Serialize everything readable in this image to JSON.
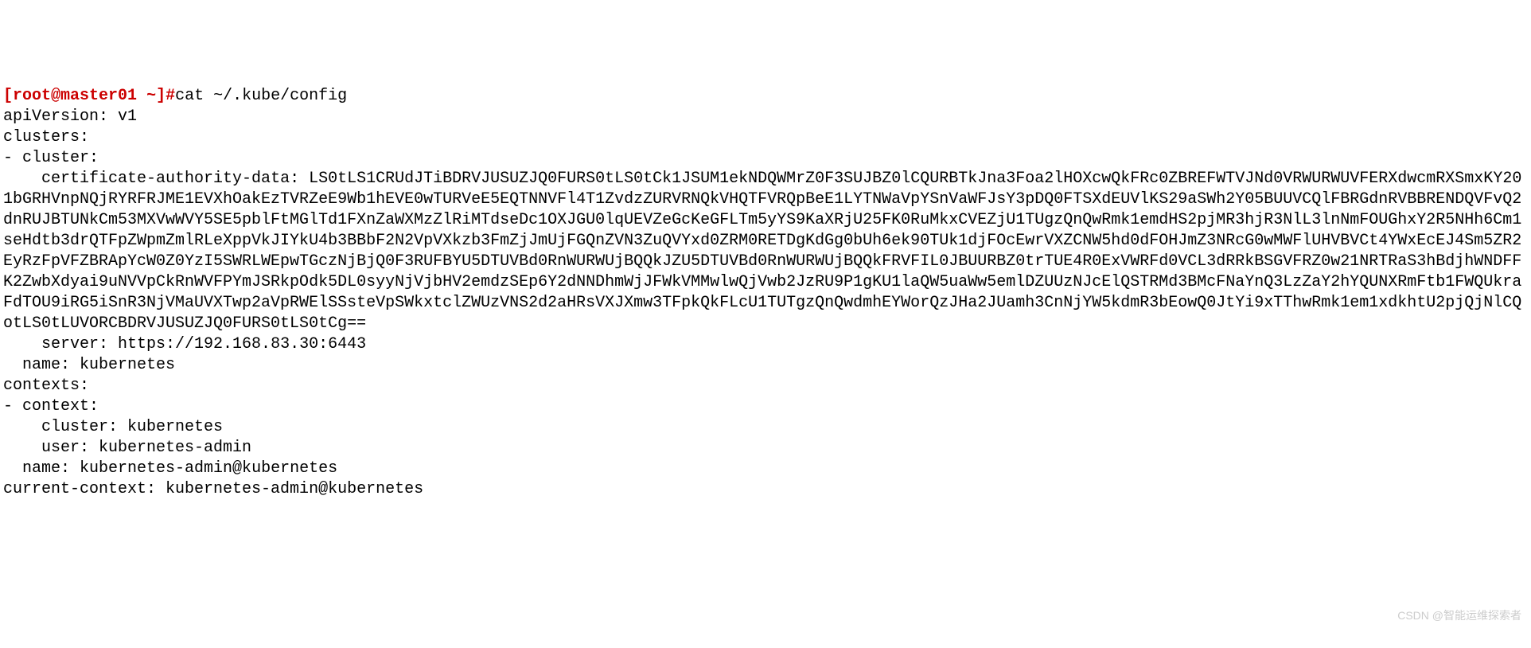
{
  "prompt": {
    "open_bracket": "[",
    "user": "root",
    "at": "@",
    "host": "master01",
    "path": " ~",
    "close_bracket": "]",
    "hash": "#"
  },
  "command": "cat ~/.kube/config",
  "output": {
    "line1": "apiVersion: v1",
    "line2": "clusters:",
    "line3": "- cluster:",
    "line4": "    certificate-authority-data: LS0tLS1CRUdJTiBDRVJUSUZJQ0FURS0tLS0tCk1JSUM1ekNDQWMrZ0F3SUJBZ0lCQURBTkJna3Foa2lHOXcwQkFRc0ZBREFWTVJNd0VRWURWUVFERXdwcmRXSmxKY201bGRHVnpNQjRYRFRJME1EVXhOakEzTVRZeE9Wb1hEVE0wTURVeE5EQTNNVFl4T1ZvdzZURVRNQkVHQTFVRQpBeE1LYTNWaVpYSnVaWFJsY3pDQ0FTSXdEUVlKS29aSWh2Y05BUUVCQlFBRGdnRVBBRENDQVFvQ2dnRUJBTUNkCm53MXVwWVY5SE5pblFtMGlTd1FXnZaWXMzZlRiMTdseDc1OXJGU0lqUEVZeGcKeGFLTm5yYS9KaXRjU25FK0RuMkxCVEZjU1TUgzQnQwRmk1emdHS2pjMR3hjR3NlL3lnNmFOUGhxY2R5NHh6Cm1seHdtb3drQTFpZWpmZmlRLeXppVkJIYkU4b3BBbF2N2VpVXkzb3FmZjJmUjFGQnZVN3ZuQVYxd0ZRM0RETDgKdGg0bUh6ek90TUk1djFOcEwrVXZCNW5hd0dFOHJmZ3NRcG0wMWFlUHVBVCt4YWxEcEJ4Sm5ZR2EyRzFpVFZBRApYcW0Z0YzI5SWRLWEpwTGczNjBjQ0F3RUFBYU5DTUVBd0RnWURWUjBQQkJZU5DTUVBd0RnWURWUjBQQkFRVFIL0JBUURBZ0trTUE4R0ExVWRFd0VCL3dRRkBSGVFRZ0w21NRTRaS3hBdjhWNDFFK2ZwbXdyai9uNVVpCkRnWVFPYmJSRkpOdk5DL0syyNjVjbHV2emdzSEp6Y2dNNDhmWjJFWkVMMwlwQjVwb2JzRU9P1gKU1laQW5uaWw5emlDZUUzNJcElQSTRMd3BMcFNaYnQ3LzZaY2hYQUNXRmFtb1FWQUkraFdTOU9iRG5iSnR3NjVMaUVXTwp2aVpRWElSSsteVpSWkxtclZWUzVNS2d2aHRsVXJXmw3TFpkQkFLcU1TUTgzQnQwdmhEYWorQzJHa2JUamh3CnNjYW5kdmR3bEowQ0JtYi9xTThwRmk1em1xdkhtU2pjQjNlCQotLS0tLUVORCBDRVJUSUZJQ0FURS0tLS0tCg==",
    "line5": "    server: https://192.168.83.30:6443",
    "line6": "  name: kubernetes",
    "line7": "contexts:",
    "line8": "- context:",
    "line9": "    cluster: kubernetes",
    "line10": "    user: kubernetes-admin",
    "line11": "  name: kubernetes-admin@kubernetes",
    "line12": "current-context: kubernetes-admin@kubernetes"
  },
  "watermark": "CSDN @智能运维探索者"
}
